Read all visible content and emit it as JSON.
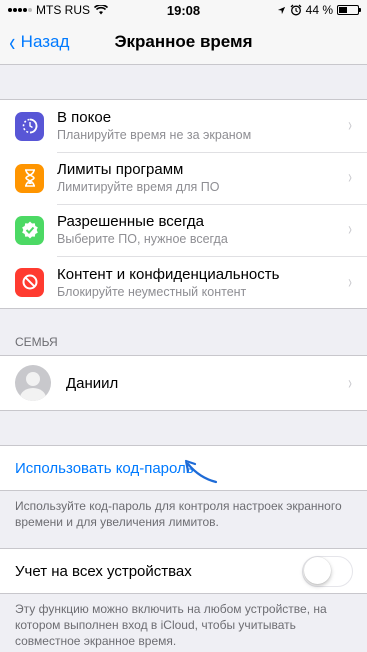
{
  "status": {
    "carrier": "MTS RUS",
    "time": "19:08",
    "battery": "44 %",
    "battery_level": 0.44
  },
  "nav": {
    "back_label": "Назад",
    "title": "Экранное время"
  },
  "settings": [
    {
      "title": "В покое",
      "subtitle": "Планируйте время не за экраном",
      "icon": "downtime-icon",
      "color": "#5856d6"
    },
    {
      "title": "Лимиты программ",
      "subtitle": "Лимитируйте время для ПО",
      "icon": "hourglass-icon",
      "color": "#ff9500"
    },
    {
      "title": "Разрешенные всегда",
      "subtitle": "Выберите ПО, нужное всегда",
      "icon": "checkmark-badge-icon",
      "color": "#4cd964"
    },
    {
      "title": "Контент и конфиденциальность",
      "subtitle": "Блокируйте неуместный контент",
      "icon": "restriction-icon",
      "color": "#ff3b30"
    }
  ],
  "family": {
    "header": "СЕМЬЯ",
    "member_name": "Даниил"
  },
  "passcode": {
    "link": "Использовать код-пароль",
    "footer": "Используйте код-пароль для контроля настроек экранного времени и для увеличения лимитов."
  },
  "share": {
    "label": "Учет на всех устройствах",
    "enabled": false,
    "footer": "Эту функцию можно включить на любом устройстве, на котором выполнен вход в iCloud, чтобы учитывать совместное экранное время."
  }
}
